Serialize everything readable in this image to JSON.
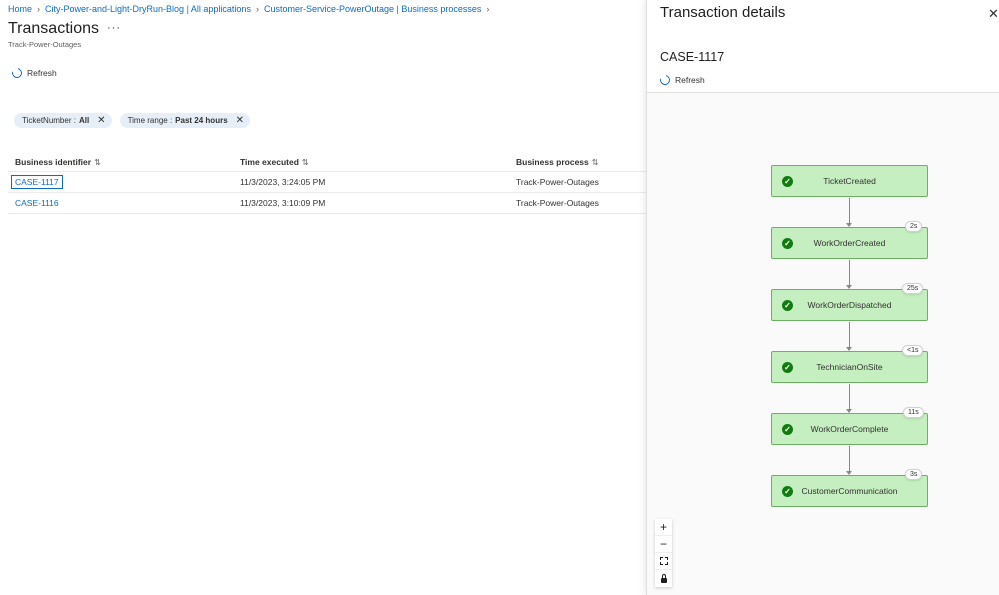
{
  "breadcrumb": [
    {
      "label": "Home"
    },
    {
      "label": "City-Power-and-Light-DryRun-Blog | All applications"
    },
    {
      "label": "Customer-Service-PowerOutage | Business processes"
    }
  ],
  "page": {
    "title": "Transactions",
    "more_label": "···",
    "subtitle": "Track-Power-Outages",
    "refresh_label": "Refresh"
  },
  "filters": [
    {
      "key": "TicketNumber : ",
      "value": "All",
      "remove": "✕"
    },
    {
      "key": "Time range : ",
      "value": "Past 24 hours",
      "remove": "✕"
    }
  ],
  "table": {
    "columns": [
      "Business identifier",
      "Time executed",
      "Business process"
    ],
    "sort_glyph": "⇅",
    "rows": [
      {
        "id": "CASE-1117",
        "time": "11/3/2023, 3:24:05 PM",
        "process": "Track-Power-Outages"
      },
      {
        "id": "CASE-1116",
        "time": "11/3/2023, 3:10:09 PM",
        "process": "Track-Power-Outages"
      }
    ]
  },
  "details": {
    "title": "Transaction details",
    "close": "✕",
    "case": "CASE-1117",
    "refresh_label": "Refresh",
    "steps": [
      {
        "name": "TicketCreated",
        "duration": ""
      },
      {
        "name": "WorkOrderCreated",
        "duration": "2s"
      },
      {
        "name": "WorkOrderDispatched",
        "duration": "25s"
      },
      {
        "name": "TechnicianOnSite",
        "duration": "<1s"
      },
      {
        "name": "WorkOrderComplete",
        "duration": "11s"
      },
      {
        "name": "CustomerCommunication",
        "duration": "3s"
      }
    ],
    "zoom": {
      "in": "+",
      "out": "−"
    }
  },
  "colors": {
    "accent": "#0f6cbd",
    "node_fill": "#c6efc1",
    "node_border": "#6bb063",
    "check": "#107c10"
  },
  "icons": [
    "refresh-icon",
    "close-icon",
    "check-icon",
    "fit-view-icon",
    "lock-icon",
    "sort-icon",
    "chevron-right-icon"
  ]
}
